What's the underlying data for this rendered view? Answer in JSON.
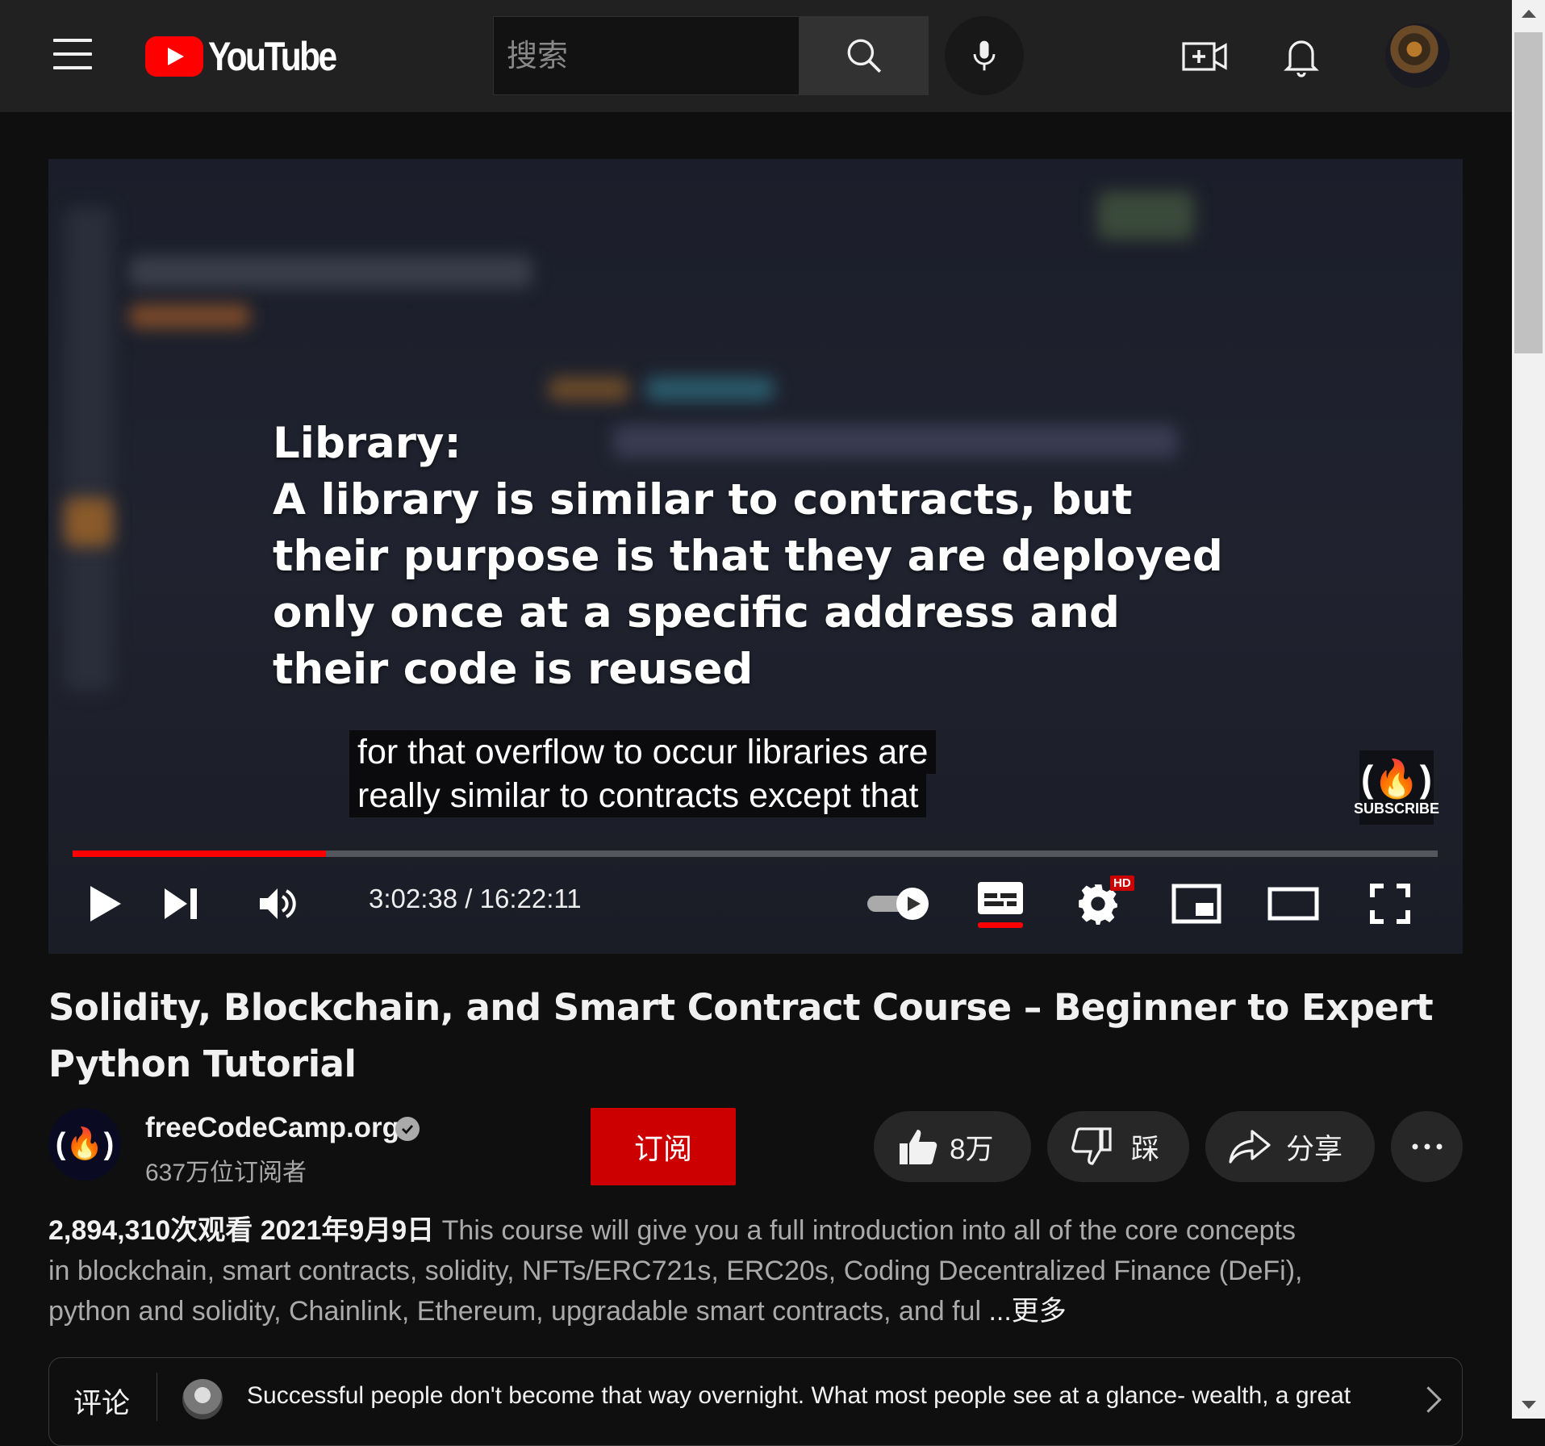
{
  "header": {
    "logo_text": "YouTube",
    "search_placeholder": "搜索"
  },
  "player": {
    "slide_lines": [
      "Library:",
      "A library is similar to contracts, but",
      "their purpose is that they are deployed",
      "only once at a specific address and",
      "their code is reused"
    ],
    "caption_lines": [
      "for that overflow to occur libraries are",
      "really similar to contracts except that"
    ],
    "watermark_text": "SUBSCRIBE",
    "watermark_logo": "(🔥)",
    "time": "3:02:38 / 16:22:11",
    "progress_fraction": 0.1856,
    "hd_badge": "HD"
  },
  "video": {
    "title": "Solidity, Blockchain, and Smart Contract Course – Beginner to Expert Python Tutorial",
    "channel_name": "freeCodeCamp.org",
    "channel_avatar_text": "(🔥)",
    "subscribers": "637万位订阅者",
    "subscribe_label": "订阅",
    "like_count": "8万",
    "dislike_label": "踩",
    "share_label": "分享"
  },
  "description": {
    "views": "2,894,310次观看",
    "date": "2021年9月9日",
    "text": "This course will give you a full introduction into all of the core concepts in blockchain, smart contracts, solidity, NFTs/ERC721s, ERC20s, Coding Decentralized Finance (DeFi), python and solidity, Chainlink, Ethereum, upgradable smart contracts, and ful",
    "more_label": "...更多"
  },
  "comments": {
    "label": "评论",
    "preview": "Successful people don't become that way overnight. What most people see at a glance- wealth, a great"
  },
  "colors": {
    "accent_red": "#ff0000",
    "subscribe_red": "#cc0000",
    "background": "#0f0f0f",
    "header_bg": "#212121"
  }
}
